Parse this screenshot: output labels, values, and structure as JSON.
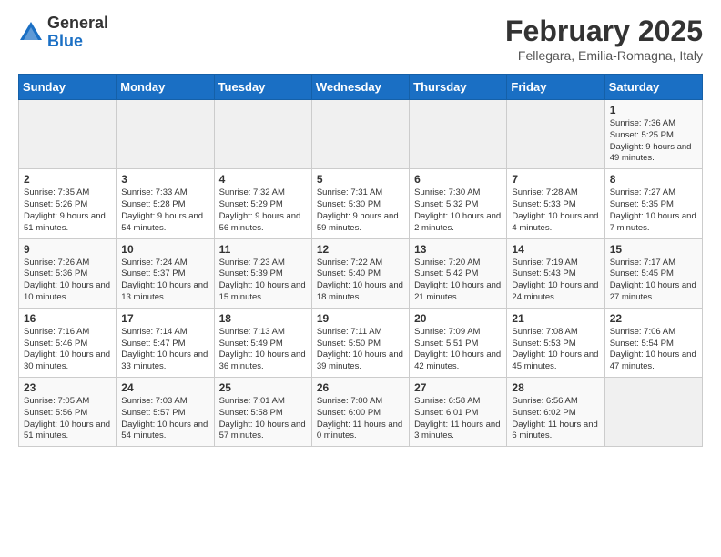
{
  "header": {
    "logo": {
      "general": "General",
      "blue": "Blue"
    },
    "title": "February 2025",
    "location": "Fellegara, Emilia-Romagna, Italy"
  },
  "calendar": {
    "days_of_week": [
      "Sunday",
      "Monday",
      "Tuesday",
      "Wednesday",
      "Thursday",
      "Friday",
      "Saturday"
    ],
    "weeks": [
      [
        {
          "day": "",
          "info": ""
        },
        {
          "day": "",
          "info": ""
        },
        {
          "day": "",
          "info": ""
        },
        {
          "day": "",
          "info": ""
        },
        {
          "day": "",
          "info": ""
        },
        {
          "day": "",
          "info": ""
        },
        {
          "day": "1",
          "info": "Sunrise: 7:36 AM\nSunset: 5:25 PM\nDaylight: 9 hours and 49 minutes."
        }
      ],
      [
        {
          "day": "2",
          "info": "Sunrise: 7:35 AM\nSunset: 5:26 PM\nDaylight: 9 hours and 51 minutes."
        },
        {
          "day": "3",
          "info": "Sunrise: 7:33 AM\nSunset: 5:28 PM\nDaylight: 9 hours and 54 minutes."
        },
        {
          "day": "4",
          "info": "Sunrise: 7:32 AM\nSunset: 5:29 PM\nDaylight: 9 hours and 56 minutes."
        },
        {
          "day": "5",
          "info": "Sunrise: 7:31 AM\nSunset: 5:30 PM\nDaylight: 9 hours and 59 minutes."
        },
        {
          "day": "6",
          "info": "Sunrise: 7:30 AM\nSunset: 5:32 PM\nDaylight: 10 hours and 2 minutes."
        },
        {
          "day": "7",
          "info": "Sunrise: 7:28 AM\nSunset: 5:33 PM\nDaylight: 10 hours and 4 minutes."
        },
        {
          "day": "8",
          "info": "Sunrise: 7:27 AM\nSunset: 5:35 PM\nDaylight: 10 hours and 7 minutes."
        }
      ],
      [
        {
          "day": "9",
          "info": "Sunrise: 7:26 AM\nSunset: 5:36 PM\nDaylight: 10 hours and 10 minutes."
        },
        {
          "day": "10",
          "info": "Sunrise: 7:24 AM\nSunset: 5:37 PM\nDaylight: 10 hours and 13 minutes."
        },
        {
          "day": "11",
          "info": "Sunrise: 7:23 AM\nSunset: 5:39 PM\nDaylight: 10 hours and 15 minutes."
        },
        {
          "day": "12",
          "info": "Sunrise: 7:22 AM\nSunset: 5:40 PM\nDaylight: 10 hours and 18 minutes."
        },
        {
          "day": "13",
          "info": "Sunrise: 7:20 AM\nSunset: 5:42 PM\nDaylight: 10 hours and 21 minutes."
        },
        {
          "day": "14",
          "info": "Sunrise: 7:19 AM\nSunset: 5:43 PM\nDaylight: 10 hours and 24 minutes."
        },
        {
          "day": "15",
          "info": "Sunrise: 7:17 AM\nSunset: 5:45 PM\nDaylight: 10 hours and 27 minutes."
        }
      ],
      [
        {
          "day": "16",
          "info": "Sunrise: 7:16 AM\nSunset: 5:46 PM\nDaylight: 10 hours and 30 minutes."
        },
        {
          "day": "17",
          "info": "Sunrise: 7:14 AM\nSunset: 5:47 PM\nDaylight: 10 hours and 33 minutes."
        },
        {
          "day": "18",
          "info": "Sunrise: 7:13 AM\nSunset: 5:49 PM\nDaylight: 10 hours and 36 minutes."
        },
        {
          "day": "19",
          "info": "Sunrise: 7:11 AM\nSunset: 5:50 PM\nDaylight: 10 hours and 39 minutes."
        },
        {
          "day": "20",
          "info": "Sunrise: 7:09 AM\nSunset: 5:51 PM\nDaylight: 10 hours and 42 minutes."
        },
        {
          "day": "21",
          "info": "Sunrise: 7:08 AM\nSunset: 5:53 PM\nDaylight: 10 hours and 45 minutes."
        },
        {
          "day": "22",
          "info": "Sunrise: 7:06 AM\nSunset: 5:54 PM\nDaylight: 10 hours and 47 minutes."
        }
      ],
      [
        {
          "day": "23",
          "info": "Sunrise: 7:05 AM\nSunset: 5:56 PM\nDaylight: 10 hours and 51 minutes."
        },
        {
          "day": "24",
          "info": "Sunrise: 7:03 AM\nSunset: 5:57 PM\nDaylight: 10 hours and 54 minutes."
        },
        {
          "day": "25",
          "info": "Sunrise: 7:01 AM\nSunset: 5:58 PM\nDaylight: 10 hours and 57 minutes."
        },
        {
          "day": "26",
          "info": "Sunrise: 7:00 AM\nSunset: 6:00 PM\nDaylight: 11 hours and 0 minutes."
        },
        {
          "day": "27",
          "info": "Sunrise: 6:58 AM\nSunset: 6:01 PM\nDaylight: 11 hours and 3 minutes."
        },
        {
          "day": "28",
          "info": "Sunrise: 6:56 AM\nSunset: 6:02 PM\nDaylight: 11 hours and 6 minutes."
        },
        {
          "day": "",
          "info": ""
        }
      ]
    ]
  }
}
